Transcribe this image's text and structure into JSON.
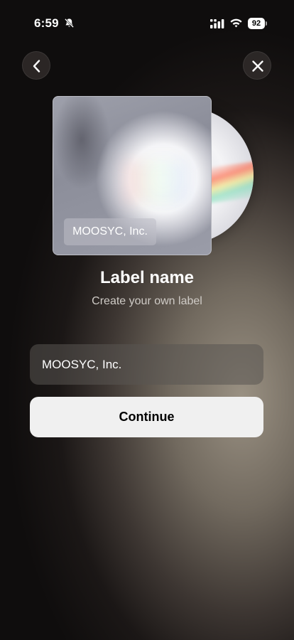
{
  "status_bar": {
    "time": "6:59",
    "battery_level": "92",
    "icons": [
      "bell-slash-icon",
      "signal-icon",
      "wifi-icon",
      "battery-icon"
    ]
  },
  "nav": {
    "back_icon": "chevron-left-icon",
    "close_icon": "close-icon"
  },
  "artwork": {
    "cover_label": "MOOSYC, Inc."
  },
  "header": {
    "title": "Label name",
    "subtitle": "Create your own label"
  },
  "form": {
    "label_name_value": "MOOSYC, Inc.",
    "continue_label": "Continue"
  },
  "colors": {
    "background": "#121010",
    "button_background": "#f0f0f0",
    "field_background": "#5a5652"
  }
}
